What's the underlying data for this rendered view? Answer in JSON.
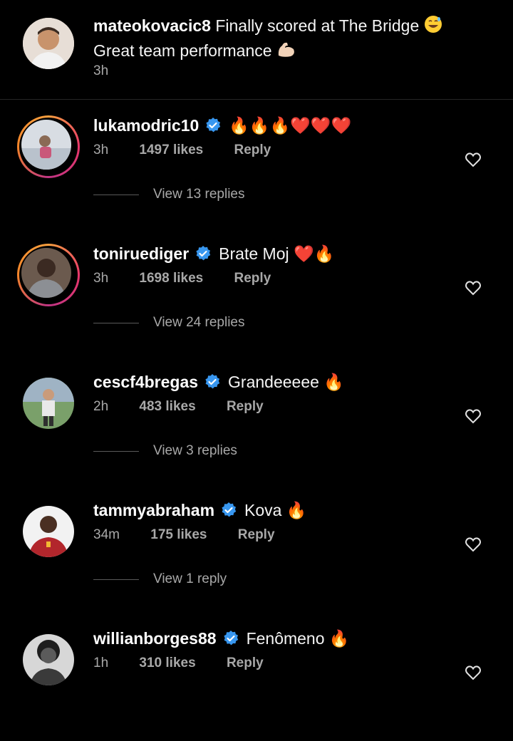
{
  "caption": {
    "username": "mateokovacic8",
    "text": "Finally scored at The Bridge",
    "text2": "Great team performance",
    "time": "3h",
    "emojis": [
      "grin-sweat-emoji",
      "flexed-biceps-emoji"
    ]
  },
  "comments": [
    {
      "username": "lukamodric10",
      "text": "",
      "emojis": "🔥🔥🔥❤️❤️❤️",
      "time": "3h",
      "likes": "1497 likes",
      "reply": "Reply",
      "view_replies": "View 13 replies",
      "ring": true
    },
    {
      "username": "toniruediger",
      "text": "Brate Moj",
      "emojis": "❤️🔥",
      "time": "3h",
      "likes": "1698 likes",
      "reply": "Reply",
      "view_replies": "View 24 replies",
      "ring": true
    },
    {
      "username": "cescf4bregas",
      "text": "Grandeeeee",
      "emojis": "🔥",
      "time": "2h",
      "likes": "483 likes",
      "reply": "Reply",
      "view_replies": "View 3 replies",
      "ring": false
    },
    {
      "username": "tammyabraham",
      "text": "Kova",
      "emojis": "🔥",
      "time": "34m",
      "likes": "175 likes",
      "reply": "Reply",
      "view_replies": "View 1 reply",
      "ring": false
    },
    {
      "username": "willianborges88",
      "text": "Fenômeno",
      "emojis": "🔥",
      "time": "1h",
      "likes": "310 likes",
      "reply": "Reply",
      "view_replies": "",
      "ring": false
    }
  ],
  "colors": {
    "background": "#000000",
    "secondary_text": "#a8a8a8",
    "verified_blue": "#3897f0",
    "fire": "#f7931e",
    "heart_red": "#e0245e"
  },
  "icons": [
    "verified-badge-icon",
    "heart-outline-icon",
    "fire-emoji",
    "red-heart-emoji"
  ]
}
